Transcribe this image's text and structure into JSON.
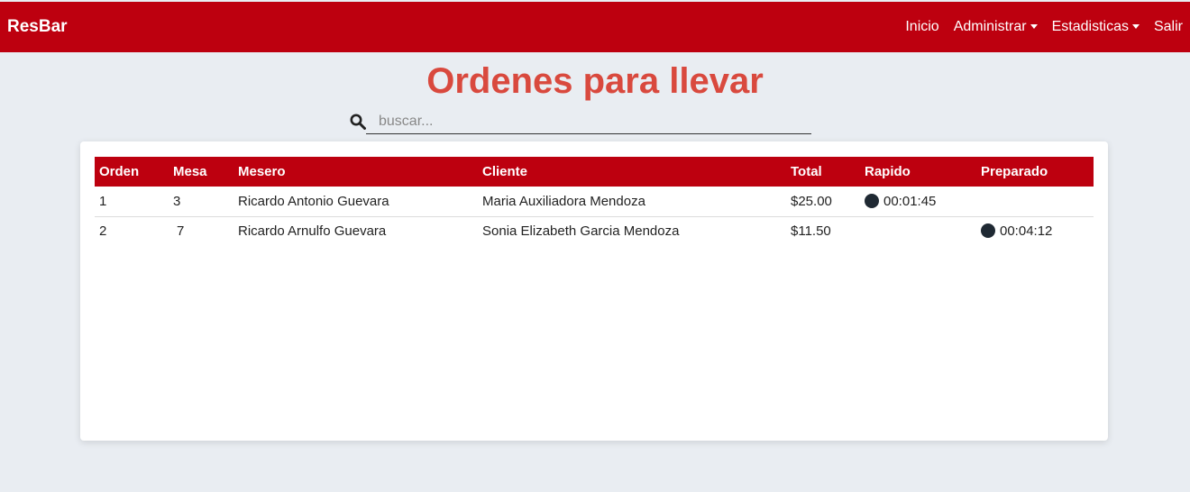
{
  "navbar": {
    "brand": "ResBar",
    "links": [
      {
        "label": "Inicio",
        "dropdown": false
      },
      {
        "label": "Administrar",
        "dropdown": true
      },
      {
        "label": "Estadisticas",
        "dropdown": true
      },
      {
        "label": "Salir",
        "dropdown": false
      }
    ],
    "color": "#bd000f"
  },
  "page_title": "Ordenes para llevar",
  "search": {
    "placeholder": "buscar...",
    "value": "",
    "icon": "search-icon"
  },
  "table": {
    "headers": [
      "Orden",
      "Mesa",
      "Mesero",
      "Cliente",
      "Total",
      "Rapido",
      "Preparado"
    ],
    "rows": [
      {
        "orden": "1",
        "mesa": "3",
        "mesero": "Ricardo Antonio Guevara",
        "cliente": "Maria Auxiliadora Mendoza",
        "total": "$25.00",
        "rapido": "00:01:45",
        "preparado": ""
      },
      {
        "orden": "2",
        "mesa": "7",
        "mesero": "Ricardo Arnulfo Guevara",
        "cliente": "Sonia Elizabeth Garcia Mendoza",
        "total": "$11.50",
        "rapido": "",
        "preparado": "00:04:12"
      }
    ]
  },
  "colors": {
    "accent": "#bd000f",
    "title": "#d9493e",
    "background": "#e9edf2",
    "status_dot": "#1f2933"
  }
}
